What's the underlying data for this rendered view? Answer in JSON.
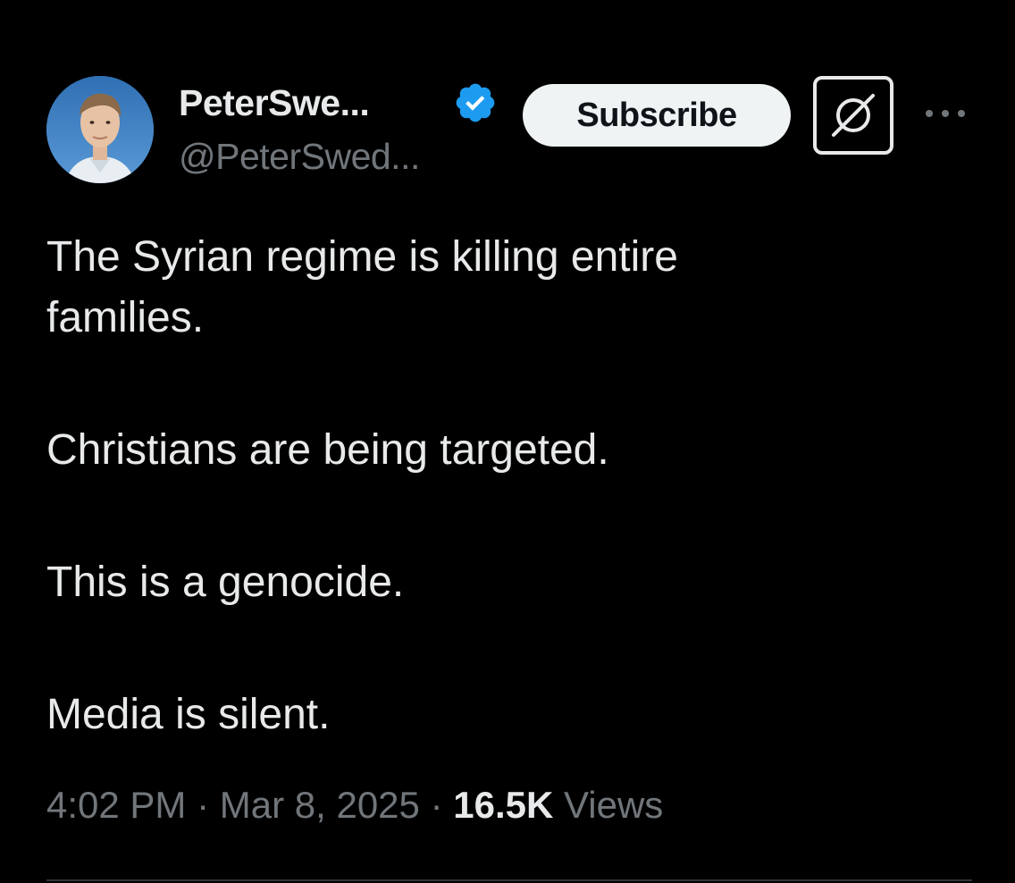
{
  "author": {
    "display_name": "PeterSwe...",
    "handle": "@PeterSwed...",
    "verified": true,
    "avatar_icon": "profile-photo"
  },
  "actions": {
    "subscribe_label": "Subscribe",
    "grok_icon": "grok-icon",
    "more_icon": "more-icon"
  },
  "tweet": {
    "paragraphs": [
      "The Syrian regime is killing entire families.",
      "Christians are being targeted.",
      "This is a genocide.",
      "Media is silent."
    ]
  },
  "meta": {
    "time": "4:02 PM",
    "separator": "·",
    "date": "Mar 8, 2025",
    "views_count": "16.5K",
    "views_label": "Views"
  },
  "colors": {
    "background": "#000000",
    "text_primary": "#e7e9ea",
    "text_secondary": "#71767b",
    "verified_badge": "#1d9bf0",
    "subscribe_bg": "#eff3f4"
  }
}
